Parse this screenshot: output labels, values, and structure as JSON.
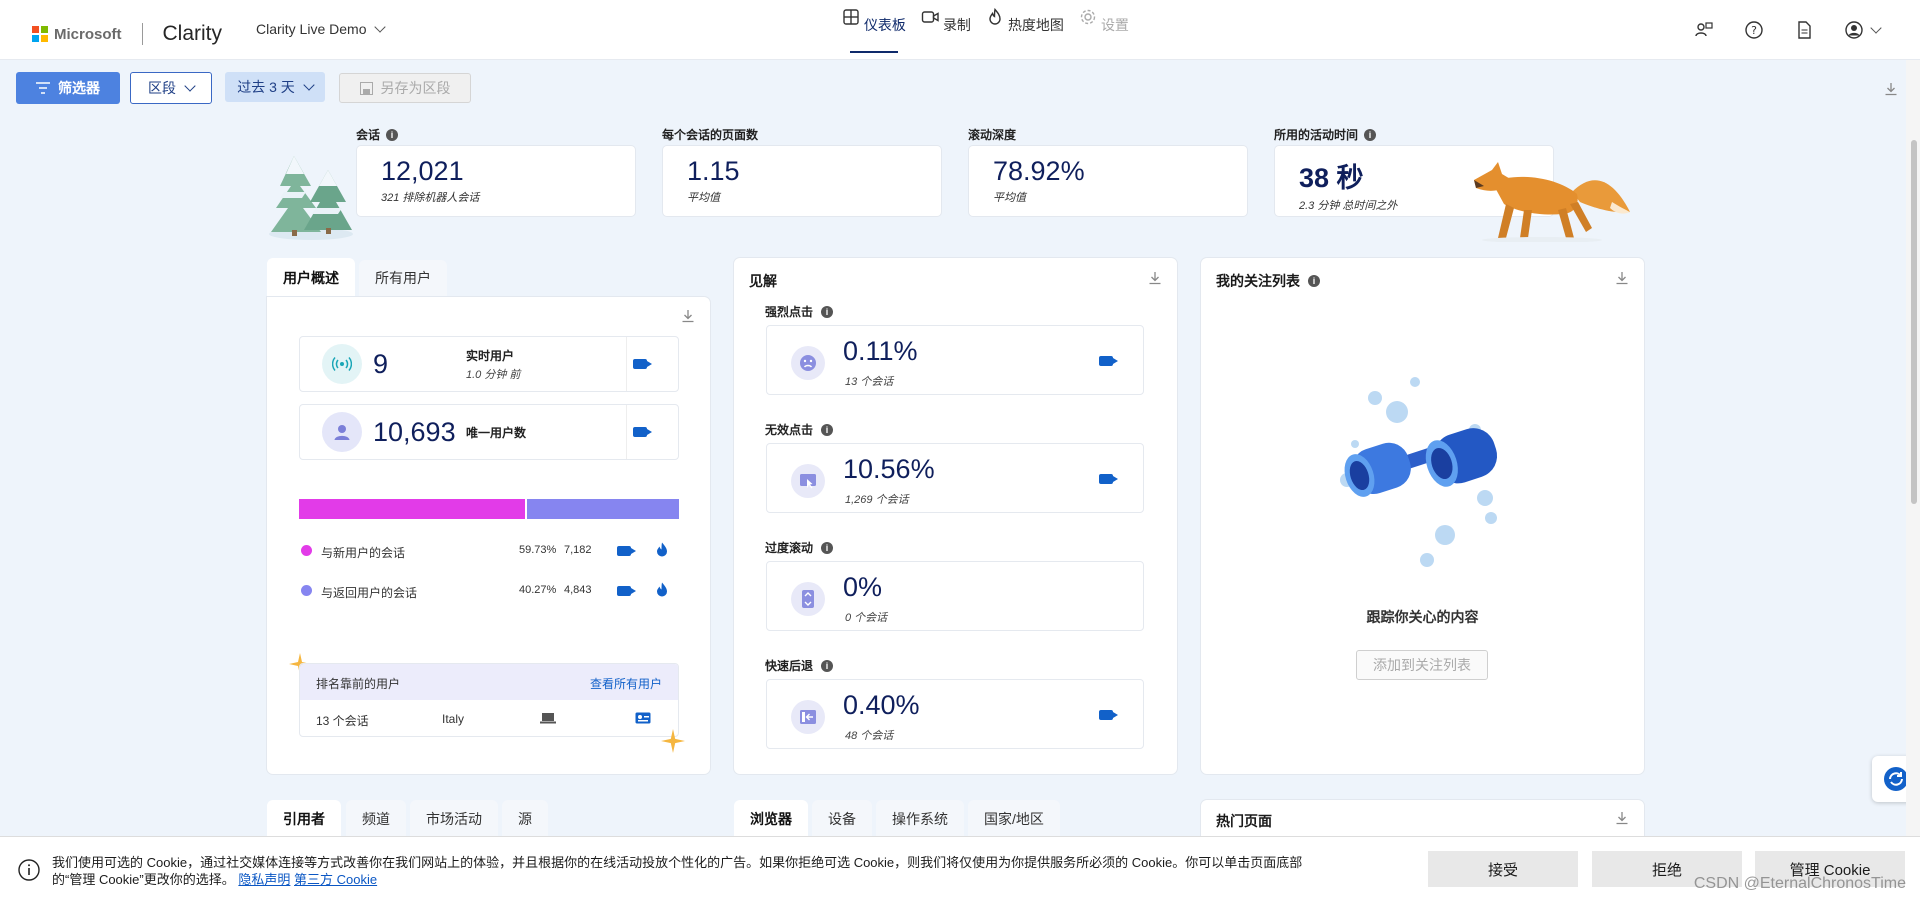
{
  "header": {
    "brand": "Microsoft",
    "product": "Clarity",
    "project": "Clarity Live Demo",
    "nav": [
      {
        "label": "仪表板",
        "icon": "dashboard-icon"
      },
      {
        "label": "录制",
        "icon": "recording-icon"
      },
      {
        "label": "热度地图",
        "icon": "heatmap-icon"
      },
      {
        "label": "设置",
        "icon": "settings-icon"
      }
    ]
  },
  "filters": {
    "filter_label": "筛选器",
    "segment_label": "区段",
    "range_label": "过去 3 天",
    "save_label": "另存为区段"
  },
  "metrics": [
    {
      "label": "会话",
      "value": "12,021",
      "sub": "321 排除机器人会话"
    },
    {
      "label": "每个会话的页面数",
      "value": "1.15",
      "sub": "平均值"
    },
    {
      "label": "滚动深度",
      "value": "78.92%",
      "sub": "平均值"
    },
    {
      "label": "所用的活动时间",
      "value": "38 秒",
      "sub": "2.3 分钟 总时间之外"
    }
  ],
  "users_panel": {
    "tabs": [
      "用户概述",
      "所有用户"
    ],
    "live": {
      "value": "9",
      "label": "实时用户",
      "sub": "1.0 分钟 前"
    },
    "unique": {
      "value": "10,693",
      "label": "唯一用户数"
    },
    "new_share": 0.5973,
    "legend": [
      {
        "label": "与新用户的会话",
        "percent": "59.73%",
        "count": "7,182",
        "color": "#e23be8"
      },
      {
        "label": "与返回用户的会话",
        "percent": "40.27%",
        "count": "4,843",
        "color": "#8685f0"
      }
    ],
    "top_users_title": "排名靠前的用户",
    "top_users_link": "查看所有用户",
    "top_user_row": {
      "sessions": "13 个会话",
      "country": "Italy"
    }
  },
  "insights": {
    "title": "见解",
    "items": [
      {
        "label": "强烈点击",
        "value": "0.11%",
        "sub": "13 个会话",
        "icon": "frown-icon"
      },
      {
        "label": "无效点击",
        "value": "10.56%",
        "sub": "1,269 个会话",
        "icon": "dead-click-icon"
      },
      {
        "label": "过度滚动",
        "value": "0%",
        "sub": "0 个会话",
        "icon": "scroll-icon"
      },
      {
        "label": "快速后退",
        "value": "0.40%",
        "sub": "48 个会话",
        "icon": "back-icon"
      }
    ]
  },
  "watchlist": {
    "title": "我的关注列表",
    "caption": "跟踪你关心的内容",
    "button": "添加到关注列表"
  },
  "bottom_tabs": {
    "left": [
      "引用者",
      "频道",
      "市场活动",
      "源"
    ],
    "middle": [
      "浏览器",
      "设备",
      "操作系统",
      "国家/地区"
    ],
    "right_title": "热门页面"
  },
  "cookie": {
    "text": "我们使用可选的 Cookie，通过社交媒体连接等方式改善你在我们网站上的体验，并且根据你的在线活动投放个性化的广告。如果你拒绝可选 Cookie，则我们将仅使用为你提供服务所必须的 Cookie。你可以单击页面底部的“管理 Cookie”更改你的选择。",
    "privacy": "隐私声明",
    "third_party": "第三方 Cookie",
    "accept": "接受",
    "reject": "拒绝",
    "manage": "管理 Cookie"
  },
  "watermark": "CSDN @EternalChronosTime"
}
